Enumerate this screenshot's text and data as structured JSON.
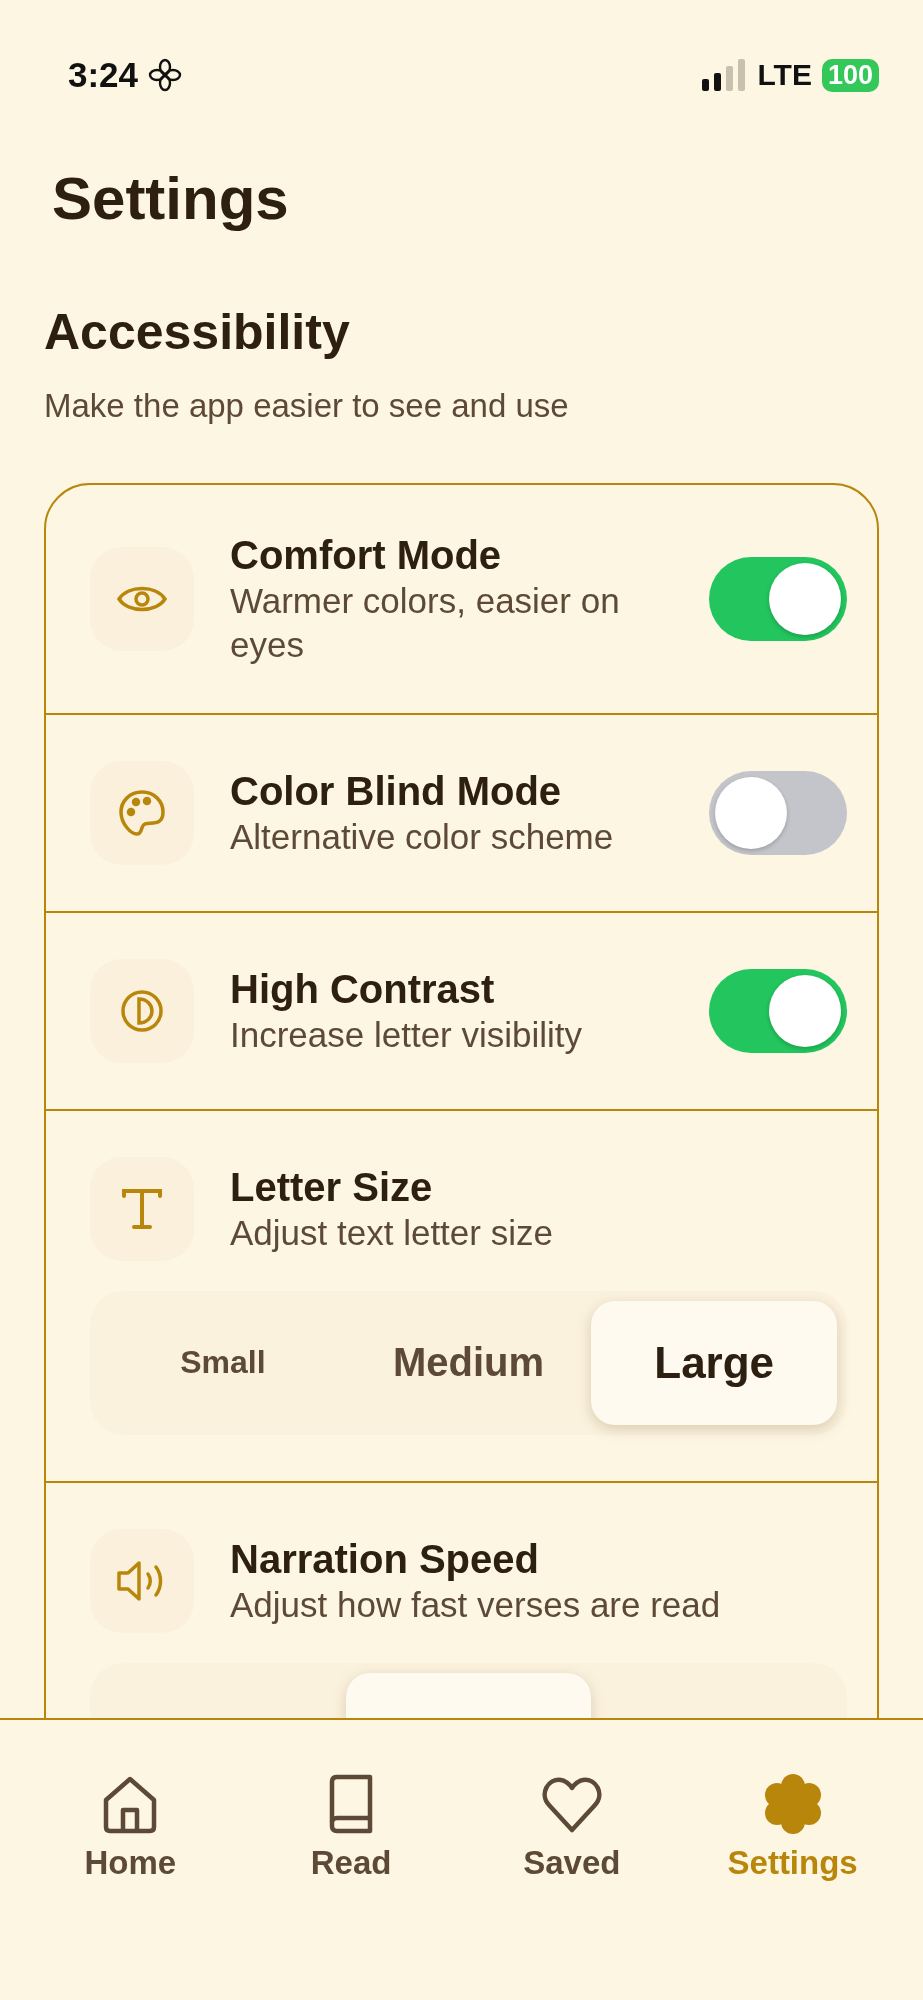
{
  "status_bar": {
    "time": "3:24",
    "network": "LTE",
    "battery": "100"
  },
  "title": "Settings",
  "section": {
    "title": "Accessibility",
    "subtitle": "Make the app easier to see and use"
  },
  "settings": [
    {
      "kind": "toggle",
      "title": "Comfort Mode",
      "subtitle": "Warmer colors, easier on eyes",
      "on": true
    },
    {
      "kind": "toggle",
      "title": "Color Blind Mode",
      "subtitle": "Alternative color scheme",
      "on": false
    },
    {
      "kind": "toggle",
      "title": "High Contrast",
      "subtitle": "Increase letter visibility",
      "on": true
    },
    {
      "kind": "choice",
      "title": "Letter Size",
      "subtitle": "Adjust text letter size",
      "options": [
        {
          "label": "Small",
          "selected": false
        },
        {
          "label": "Medium",
          "selected": false
        },
        {
          "label": "Large",
          "selected": true
        }
      ]
    },
    {
      "kind": "choice",
      "title": "Narration Speed",
      "subtitle": "Adjust how fast verses are read",
      "options": [
        {
          "selected": false
        },
        {
          "selected": true
        },
        {
          "selected": false
        }
      ]
    }
  ],
  "tabs": [
    {
      "label": "Home",
      "selected": false
    },
    {
      "label": "Read",
      "selected": false
    },
    {
      "label": "Saved",
      "selected": false
    },
    {
      "label": "Settings",
      "selected": true
    }
  ]
}
